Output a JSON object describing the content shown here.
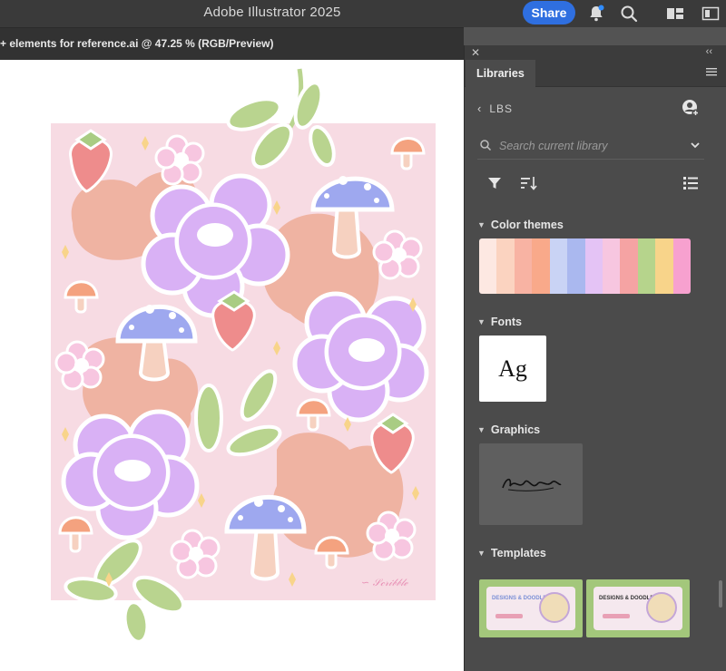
{
  "app": {
    "title": "Adobe Illustrator 2025",
    "share_label": "Share"
  },
  "document": {
    "tab_label": "+ elements for reference.ai @ 47.25 % (RGB/Preview)"
  },
  "panel": {
    "tab": "Libraries",
    "library_name": "LBS",
    "search": {
      "placeholder": "Search current library"
    },
    "sections": {
      "color_themes": "Color themes",
      "fonts": "Fonts",
      "graphics": "Graphics",
      "templates": "Templates"
    },
    "font_sample": "Ag",
    "theme_colors": [
      "#fde8e2",
      "#fbd3c0",
      "#f8b3a3",
      "#f9a98a",
      "#c9d3f5",
      "#aab8ef",
      "#e4c3f5",
      "#f7c6e0",
      "#f5a3a3",
      "#b6d48c",
      "#f8d48a",
      "#f7a1cf"
    ],
    "templates": [
      {
        "label": "DESIGNS & DOODLES"
      },
      {
        "label": "DESIGNS & DOODLES"
      }
    ]
  },
  "icons": {
    "bell": "bell-icon",
    "search": "search-icon",
    "workspace": "workspace-icon",
    "panel_toggle": "panel-toggle-icon"
  }
}
